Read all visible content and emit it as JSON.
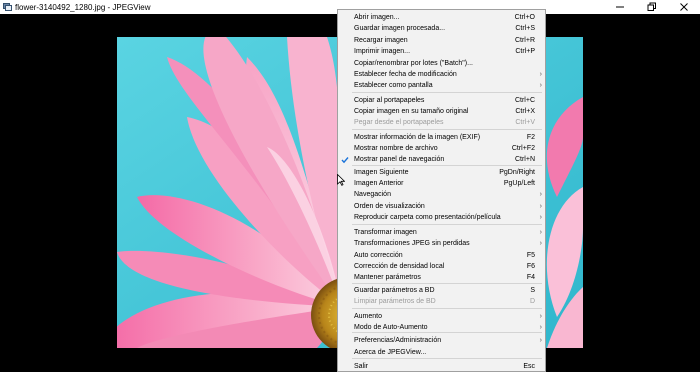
{
  "window": {
    "title": "flower-3140492_1280.jpg - JPEGView"
  },
  "icons": {
    "app": "jpegview-app-icon",
    "minimize": "minimize-icon",
    "maximize": "restore-icon",
    "close": "close-icon",
    "check": "check-icon",
    "submenu": "chevron-right-icon",
    "cursor": "mouse-pointer-icon"
  },
  "image": {
    "description_colors": {
      "background": "#3cc8d8",
      "petal": "#f07aa8",
      "center": "#c9a028"
    }
  },
  "menu": {
    "items": [
      {
        "label": "Abrir imagen...",
        "shortcut": "Ctrl+O"
      },
      {
        "label": "Guardar imagen procesada...",
        "shortcut": "Ctrl+S"
      },
      {
        "label": "Recargar imagen",
        "shortcut": "Ctrl+R"
      },
      {
        "label": "Imprimir imagen...",
        "shortcut": "Ctrl+P"
      },
      {
        "label": "Copiar/renombrar por lotes (\"Batch\")...",
        "shortcut": ""
      },
      {
        "label": "Establecer fecha de modificación",
        "shortcut": "",
        "submenu": true
      },
      {
        "label": "Establecer como pantalla",
        "shortcut": "",
        "submenu": true
      },
      {
        "label": "Copiar al portapapeles",
        "shortcut": "Ctrl+C"
      },
      {
        "label": "Copiar imagen en su tamaño original",
        "shortcut": "Ctrl+X"
      },
      {
        "label": "Pegar desde el portapapeles",
        "shortcut": "Ctrl+V",
        "disabled": true
      },
      {
        "label": "Mostrar información de la imagen (EXIF)",
        "shortcut": "F2"
      },
      {
        "label": "Mostrar nombre de archivo",
        "shortcut": "Ctrl+F2"
      },
      {
        "label": "Mostrar panel de navegación",
        "shortcut": "Ctrl+N",
        "checked": true
      },
      {
        "label": "Imagen Siguiente",
        "shortcut": "PgDn/Right"
      },
      {
        "label": "Imagen Anterior",
        "shortcut": "PgUp/Left"
      },
      {
        "label": "Navegación",
        "shortcut": "",
        "submenu": true
      },
      {
        "label": "Orden de visualización",
        "shortcut": "",
        "submenu": true
      },
      {
        "label": "Reproducir carpeta como presentación/película",
        "shortcut": "",
        "submenu": true
      },
      {
        "label": "Transformar imagen",
        "shortcut": "",
        "submenu": true
      },
      {
        "label": "Transformaciones JPEG sin perdidas",
        "shortcut": "",
        "submenu": true
      },
      {
        "label": "Auto corrección",
        "shortcut": "F5"
      },
      {
        "label": "Corrección de densidad local",
        "shortcut": "F6"
      },
      {
        "label": "Mantener parámetros",
        "shortcut": "F4"
      },
      {
        "label": "Guardar parámetros a BD",
        "shortcut": "S"
      },
      {
        "label": "Limpiar parámetros de BD",
        "shortcut": "D",
        "disabled": true
      },
      {
        "label": "Aumento",
        "shortcut": "",
        "submenu": true
      },
      {
        "label": "Modo de Auto-Aumento",
        "shortcut": "",
        "submenu": true
      },
      {
        "label": "Preferencias/Administración",
        "shortcut": "",
        "submenu": true
      },
      {
        "label": "Acerca de JPEGView...",
        "shortcut": ""
      },
      {
        "label": "Salir",
        "shortcut": "Esc"
      }
    ]
  }
}
